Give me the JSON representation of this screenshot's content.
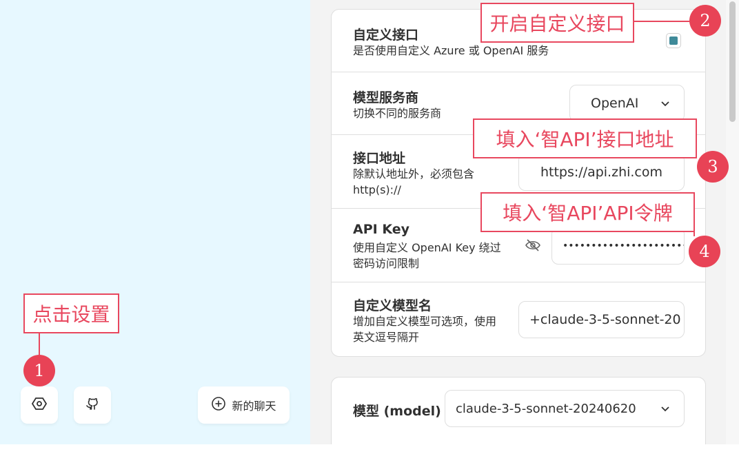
{
  "sidebar": {
    "new_chat_label": "新的聊天",
    "settings_icon": "settings-hexagon-icon",
    "github_icon": "github-icon",
    "new_chat_icon": "plus-circle-icon"
  },
  "settings": {
    "custom_endpoint": {
      "title": "自定义接口",
      "subtitle": "是否使用自定义 Azure 或 OpenAI 服务",
      "checked": true
    },
    "provider": {
      "title": "模型服务商",
      "subtitle": "切换不同的服务商",
      "value": "OpenAI"
    },
    "endpoint": {
      "title": "接口地址",
      "subtitle_line1": "除默认地址外，必须包含",
      "subtitle_line2": "http(s)://",
      "value": "https://api.zhi.com"
    },
    "api_key": {
      "title": "API Key",
      "subtitle_line1": "使用自定义 OpenAI Key 绕过",
      "subtitle_line2": "密码访问限制",
      "value": "••••••••••••••••••••••"
    },
    "custom_models": {
      "title": "自定义模型名",
      "subtitle_line1": "增加自定义模型可选项，使用",
      "subtitle_line2": "英文逗号隔开",
      "value": "+claude-3-5-sonnet-20"
    },
    "model": {
      "title": "模型 (model)",
      "value": "claude-3-5-sonnet-20240620"
    }
  },
  "annotations": {
    "step1": {
      "number": "1",
      "text": "点击设置"
    },
    "step2": {
      "number": "2",
      "text": "开启自定义接口"
    },
    "step3": {
      "number": "3",
      "text": "填入‘智API’接口地址"
    },
    "step4": {
      "number": "4",
      "text": "填入‘智API’API令牌"
    }
  },
  "colors": {
    "accent": "#e8475e",
    "sidebar_bg": "#e7f8ff",
    "checkbox": "#3f8a99"
  }
}
